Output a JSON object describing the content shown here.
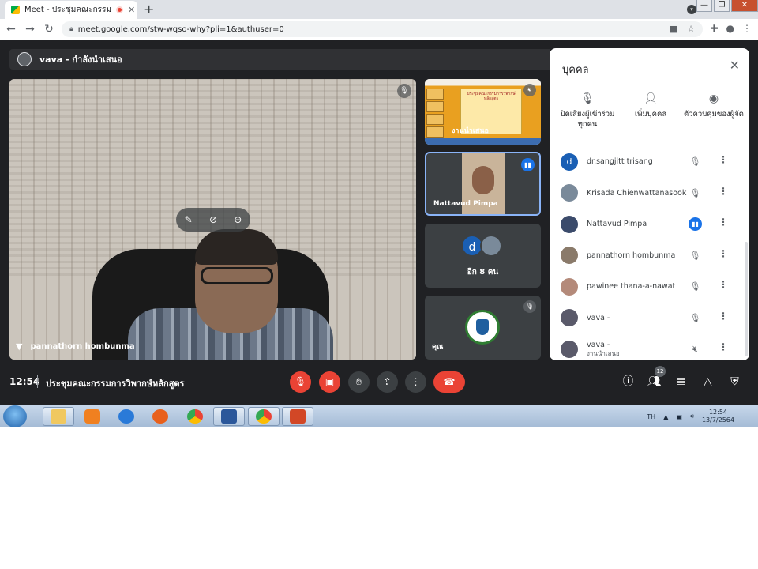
{
  "browser": {
    "tab_title": "Meet - ประชุมคณะกรรมการวิพากษ",
    "new_tab": "+",
    "url": "meet.google.com/stw-wqso-why?pli=1&authuser=0",
    "win_min": "—",
    "win_restore": "❐",
    "win_close": "✕"
  },
  "presenter": {
    "label": "vava - กำลังนำเสนอ"
  },
  "main_video": {
    "name": "pannathorn hombunma"
  },
  "tiles": {
    "presentation_label": "งานนำเสนอ",
    "slide_title": "ประชุมคณะกรรมการวิพากษ์หลักสูตร",
    "speaker_name": "Nattavud Pimpa",
    "more_count": "อีก 8 คน",
    "more_initial": "d",
    "self_label": "คุณ"
  },
  "panel": {
    "title": "บุคคล",
    "actions": [
      {
        "label": "ปิดเสียงผู้เข้าร่วมทุกคน",
        "icon": "mic-off-icon"
      },
      {
        "label": "เพิ่มบุคคล",
        "icon": "add-person-icon"
      },
      {
        "label": "ตัวควบคุมของผู้จัด",
        "icon": "host-controls-icon"
      }
    ],
    "people": [
      {
        "name": "dr.sangjitt trisang",
        "sub": "",
        "initial": "d",
        "speaking": false
      },
      {
        "name": "Krisada Chienwattanasook",
        "sub": "",
        "initial": "",
        "speaking": false
      },
      {
        "name": "Nattavud Pimpa",
        "sub": "",
        "initial": "",
        "speaking": true
      },
      {
        "name": "pannathorn hombunma",
        "sub": "",
        "initial": "",
        "speaking": false
      },
      {
        "name": "pawinee thana-a-nawat",
        "sub": "",
        "initial": "",
        "speaking": false
      },
      {
        "name": "vava -",
        "sub": "",
        "initial": "",
        "speaking": false
      },
      {
        "name": "vava -",
        "sub": "งานนำเสนอ",
        "initial": "",
        "speaking": false
      }
    ]
  },
  "controls": {
    "time": "12:54",
    "meeting_title": "ประชุมคณะกรรมการวิพากษ์หลักสูตร",
    "participant_count": "12"
  },
  "taskbar": {
    "lang": "TH",
    "time": "12:54",
    "date": "13/7/2564"
  },
  "colors": {
    "meet_bg": "#202124",
    "accent": "#1a73e8",
    "danger": "#ea4335"
  }
}
